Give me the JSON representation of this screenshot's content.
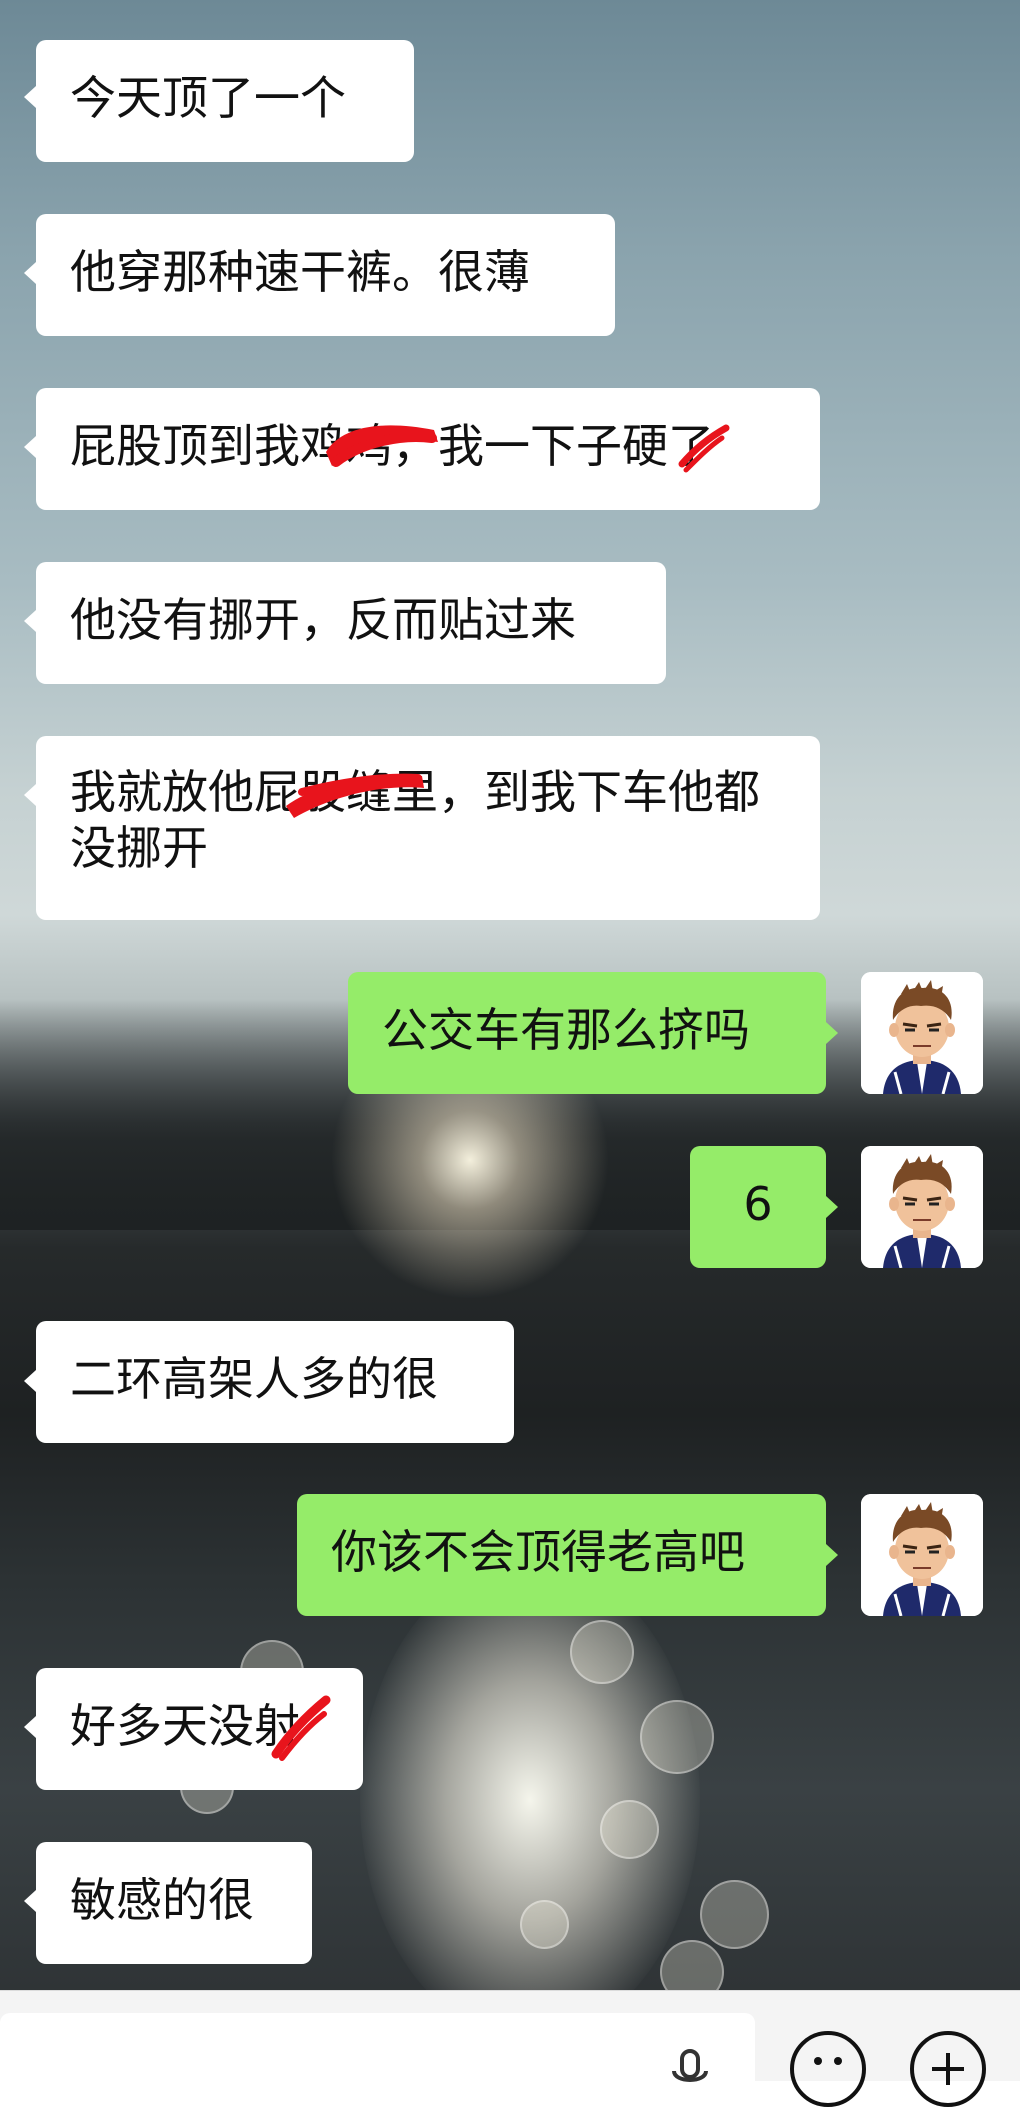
{
  "conversation": {
    "messages": [
      {
        "side": "in",
        "text": "今天顶了一个"
      },
      {
        "side": "in",
        "text": "他穿那种速干裤。很薄"
      },
      {
        "side": "in",
        "text": "屁股顶到我鸡鸡，我一下子硬了"
      },
      {
        "side": "in",
        "text": "他没有挪开，反而贴过来"
      },
      {
        "side": "in",
        "text": "我就放他屁股缝里，到我下车他都没挪开"
      },
      {
        "side": "out",
        "text": "公交车有那么挤吗"
      },
      {
        "side": "out",
        "text": "6"
      },
      {
        "side": "in",
        "text": "二环高架人多的很"
      },
      {
        "side": "out",
        "text": "你该不会顶得老高吧"
      },
      {
        "side": "in",
        "text": "好多天没射"
      },
      {
        "side": "in",
        "text": "敏感的很"
      }
    ]
  },
  "input_bar": {
    "icons": [
      "microphone-icon",
      "emoji-icon",
      "plus-icon"
    ]
  },
  "colors": {
    "incoming_bubble": "#ffffff",
    "outgoing_bubble": "#95ec69",
    "redaction": "#e8141c"
  }
}
